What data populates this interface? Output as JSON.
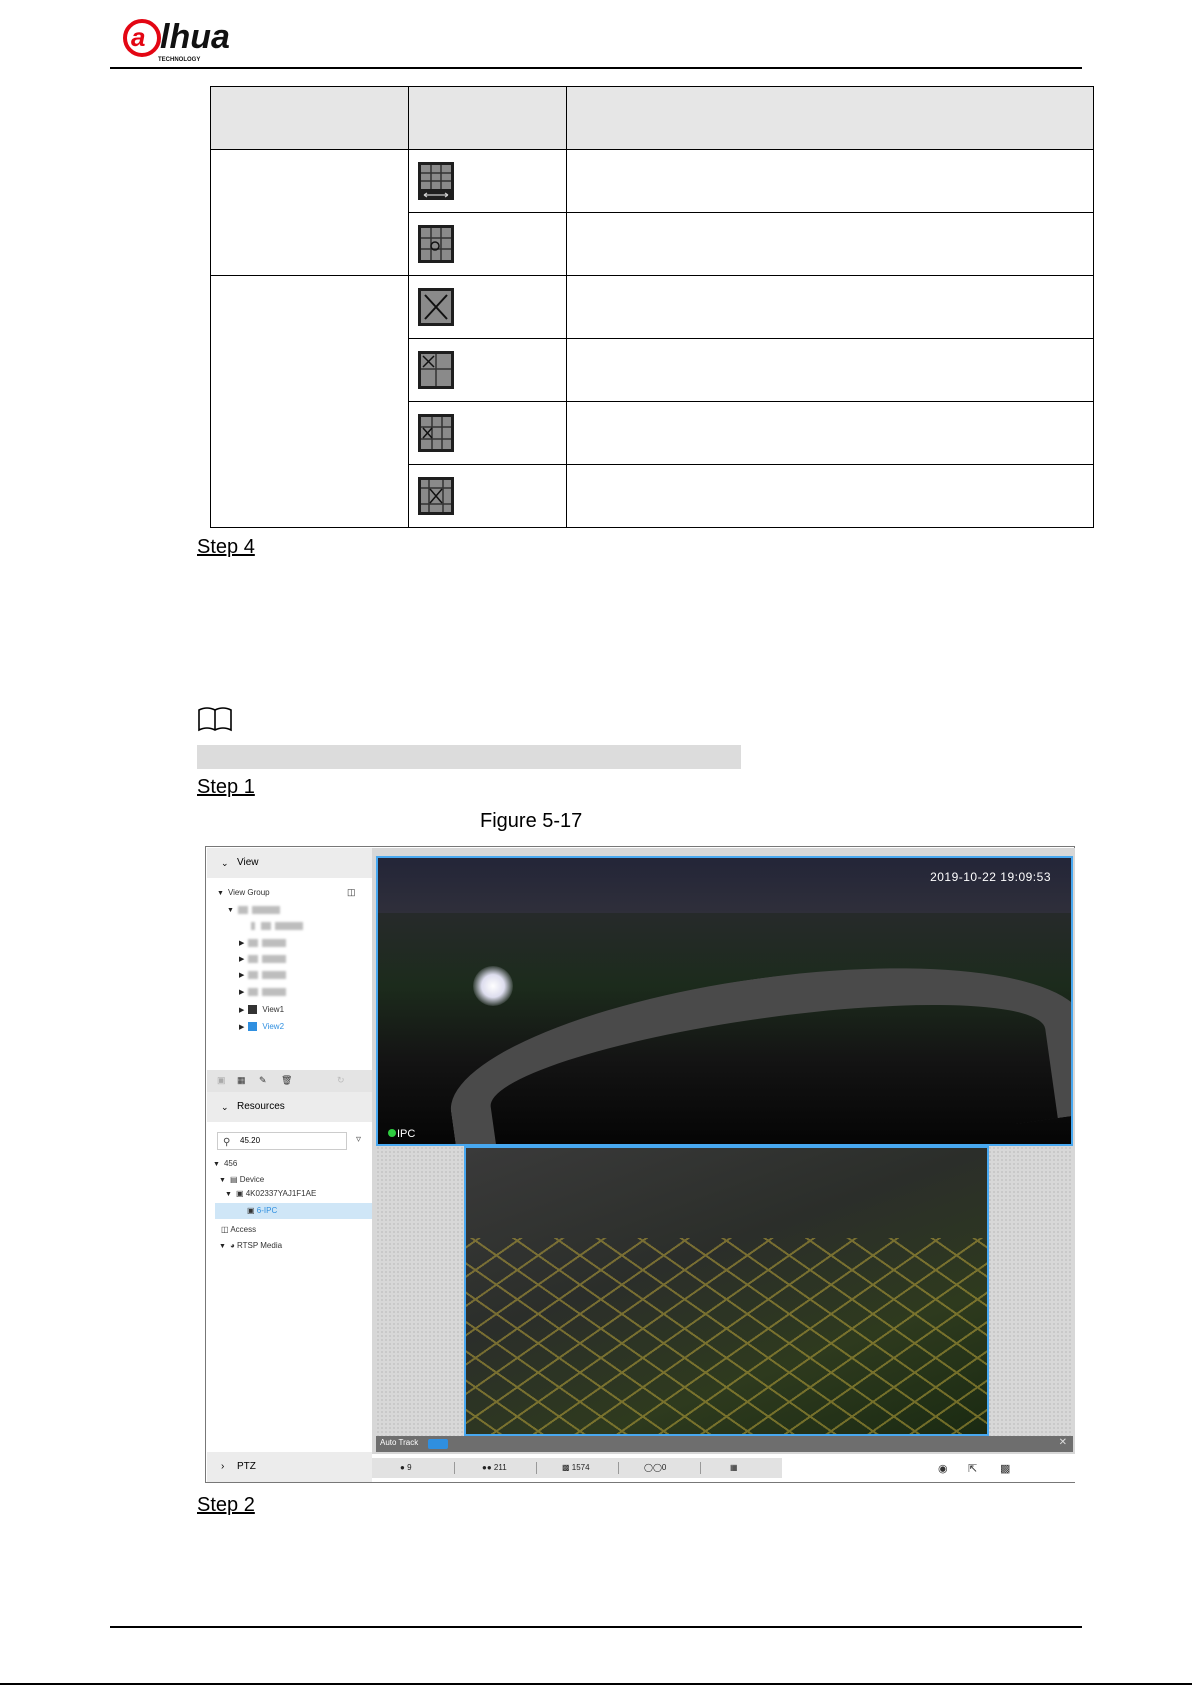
{
  "header": {
    "logo_text": "alhua",
    "logo_subtext": "TECHNOLOGY"
  },
  "steps": {
    "step4": "Step 4",
    "step1": "Step 1",
    "step2": "Step 2"
  },
  "figure": {
    "caption": "Figure 5-17"
  },
  "screenshot": {
    "view_section": "View",
    "view_group": "View Group",
    "views": [
      "View1",
      "View2"
    ],
    "resources_section": "Resources",
    "search_value": "45.20",
    "tree": {
      "root": "456",
      "device": "Device",
      "device_id": "4K02337YAJ1F1AE",
      "channel": "6-IPC",
      "access": "Access",
      "rtsp": "RTSP Media"
    },
    "ptz_section": "PTZ",
    "timestamp": "2019-10-22 19:09:53",
    "camera_label": "IPC",
    "auto_track_label": "Auto Track",
    "stats": {
      "humans": "9",
      "non_motor": "211",
      "vehicles": "1574",
      "bikes": "0"
    },
    "icons": [
      "search-icon",
      "filter-icon",
      "camera-icon",
      "fullscreen-icon",
      "window-icon",
      "close-icon"
    ]
  },
  "colors": {
    "accent_blue": "#48a8f0",
    "selected_row": "#cfe6f7",
    "toggle": "#2f8fe0"
  }
}
